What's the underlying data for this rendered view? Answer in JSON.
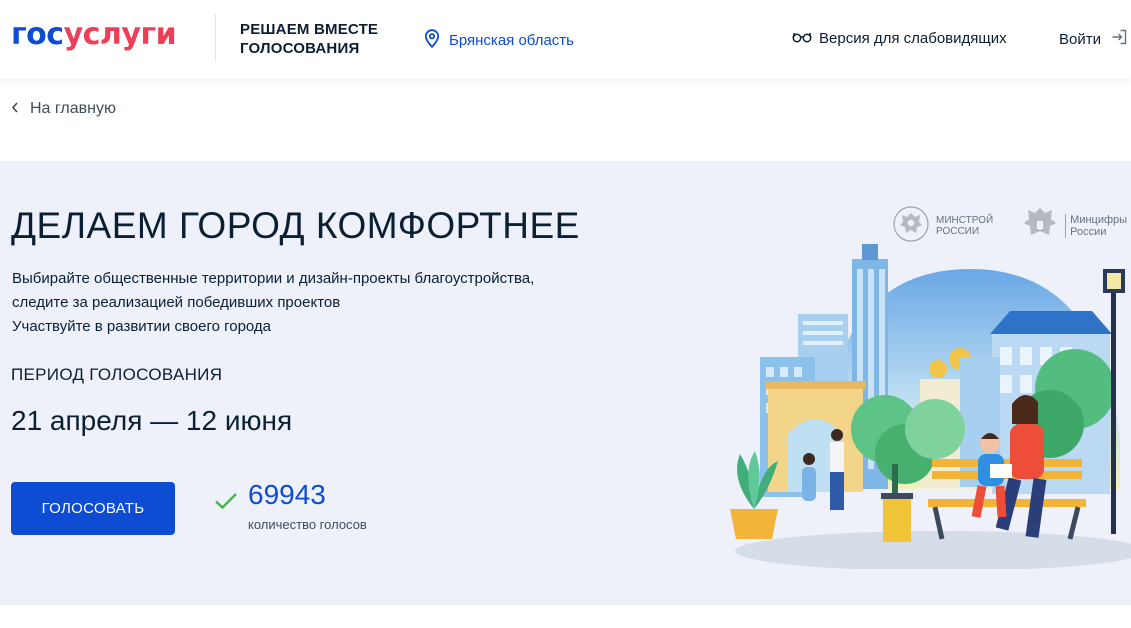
{
  "header": {
    "logo_part1": "гос",
    "logo_part2": "услуги",
    "project_line1": "РЕШАЕМ ВМЕСТЕ",
    "project_line2": "ГОЛОСОВАНИЯ",
    "region": "Брянская область",
    "accessibility": "Версия для слабовидящих",
    "login": "Войти"
  },
  "breadcrumb": {
    "back_label": "На главную"
  },
  "hero": {
    "title": "ДЕЛАЕМ ГОРОД КОМФОРТНЕЕ",
    "desc_line1": "Выбирайте общественные территории и дизайн-проекты благоустройства,",
    "desc_line2": "следите за реализацией победивших проектов",
    "desc_line3": "Участвуйте в развитии своего города",
    "period_label": "ПЕРИОД ГОЛОСОВАНИЯ",
    "period_value": "21 апреля — 12 июня",
    "vote_button": "ГОЛОСОВАТЬ",
    "votes_count": "69943",
    "votes_label": "количество голосов"
  },
  "ministries": {
    "m1_line1": "МИНСТРОЙ",
    "m1_line2": "РОССИИ",
    "m2_line1": "Минцифры",
    "m2_line2": "России"
  },
  "colors": {
    "brand_blue": "#0d4cd3",
    "brand_red": "#ee3f58",
    "hero_bg": "#eef1f9",
    "check_green": "#4caf50"
  }
}
